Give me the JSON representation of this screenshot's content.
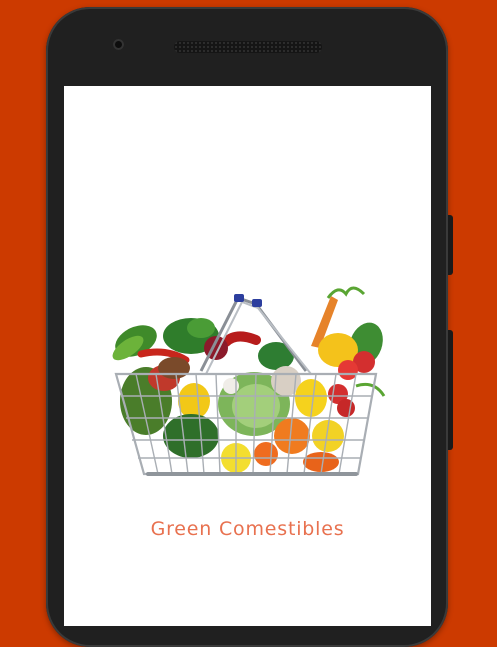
{
  "app": {
    "title": "Green Comestibles"
  },
  "images": {
    "splash": "vegetable-basket"
  },
  "colors": {
    "background": "#cc3a00",
    "title": "#e8714f"
  }
}
